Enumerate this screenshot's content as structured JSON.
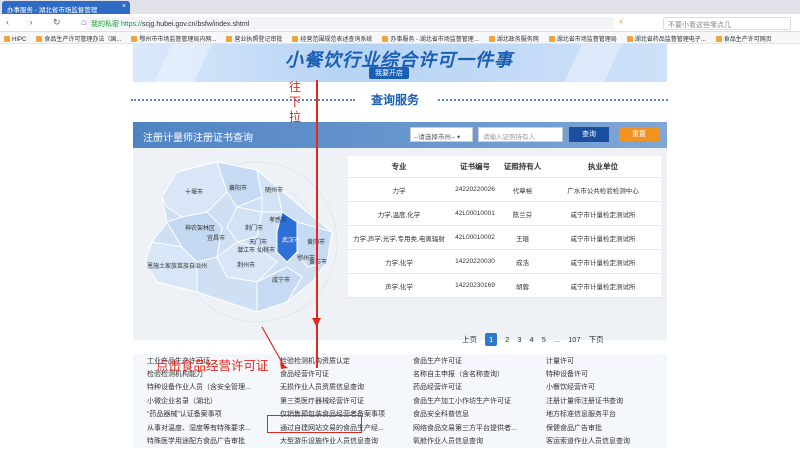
{
  "browser": {
    "tab_title": "办事服务 - 湖北省市场监督管理",
    "tab_close": "×",
    "nav_icons": "‹ › ↻ ⌂ ☆",
    "url_safe": "我的私密",
    "url_https": "https://",
    "url_rest": "scjg.hubei.gov.cn/bsfw/index.shtml",
    "search_placeholder": "不要小看这些零点几",
    "bookmarks": [
      "HIPC",
      "食品生产许可管理办法（国...",
      "鄂州市市场监督管理局内网...",
      "营业执照登记审批",
      "经营范围规范表述查询系统",
      "办事服务 - 湖北省市场监督管理...",
      "湖北政务服务网",
      "湖北省市场监督管理局",
      "湖北省药品监督管理电子...",
      "食品生产许可网页"
    ]
  },
  "banner": {
    "title": "小餐饮行业综合许可一件事",
    "subtitle": "我要开店"
  },
  "section": {
    "title": "查询服务"
  },
  "panel": {
    "title": "注册计量师注册证书查询",
    "select_text": "--请选择市州--",
    "input_placeholder": "请输入证照持有人",
    "query_button": "查询",
    "reset_button": "重置"
  },
  "map": {
    "cities": [
      "十堰市",
      "襄阳市",
      "神农架林区",
      "随州市",
      "孝感市",
      "荆门市",
      "宜昌市",
      "天门市",
      "潜江市",
      "仙桃市",
      "武汉市",
      "黄冈市",
      "荆州市",
      "咸宁市",
      "黄石市",
      "恩施土家族苗族自治州",
      "鄂州市"
    ],
    "highlight": "#2f6fd8"
  },
  "table": {
    "headers": [
      "专业",
      "证书编号",
      "证照持有人",
      "执业单位"
    ],
    "rows": [
      [
        "力学",
        "24220220026",
        "代章裕",
        "广水市公共检验检测中心"
      ],
      [
        "力学,温度,化学",
        "42L00010001",
        "陈兰芬",
        "咸宁市计量检定测试所"
      ],
      [
        "力学,声学,光学,专用类,电离辐射",
        "42L00010002",
        "王琨",
        "咸宁市计量检定测试所"
      ],
      [
        "力学,化学",
        "14220220030",
        "成浩",
        "咸宁市计量检定测试所"
      ],
      [
        "声学,化学",
        "14220230169",
        "胡蓉",
        "咸宁市计量检定测试所"
      ]
    ]
  },
  "pager": {
    "prev": "上页",
    "current": "1",
    "pages": [
      "2",
      "3",
      "4",
      "5",
      "..."
    ],
    "last": "107",
    "next": "下页"
  },
  "links": [
    [
      "工业产品生产许可证",
      "检验检测机构资质认定",
      "食品生产许可证",
      "计量许可"
    ],
    [
      "检验检测机构能力",
      "食品经营许可证",
      "名称自主申报（含名称查询）",
      "特种设备许可"
    ],
    [
      "特种设备作业人员（含安全管理...",
      "无损作业人员资质信息查询",
      "药品经营许可证",
      "小餐饮经营许可"
    ],
    [
      "小微企业名录（湖北）",
      "第三类医疗器械经营许可证",
      "食品生产加工小作坊生产许可证",
      "注册计量师注册证书查询"
    ],
    [
      "“药品器械”认证备案事项",
      "仅销售预包装食品经营者备案事项",
      "食品安全科普信息",
      "地方标准信息服务平台"
    ],
    [
      "从事对温度、湿度等有特殊要求...",
      "通过自建网站交易的食品生产经...",
      "网络食品交易第三方平台提供者...",
      "保健食品广告审批"
    ],
    [
      "特殊医学用途配方食品广告审批",
      "大型游乐设施作业人员信息查询",
      "氧舱作业人员信息查询",
      "客运索道作业人员信息查询"
    ]
  ],
  "annotations": {
    "scroll_text": "往下拉",
    "click_text": "点击食品经营许可证",
    "color": "#e2281c"
  }
}
